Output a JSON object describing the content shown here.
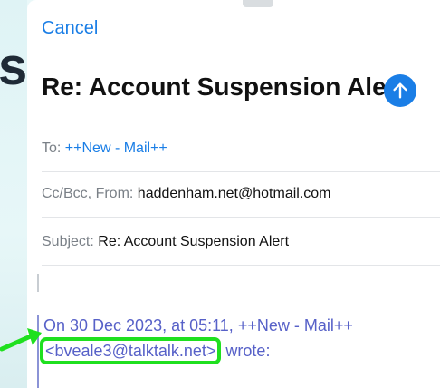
{
  "cancel_label": "Cancel",
  "title": "Re: Account Suspension Alert",
  "to_label": "To:",
  "to_value": "++New - Mail++",
  "cc_label": "Cc/Bcc, From:",
  "from_value": "haddenham.net@hotmail.com",
  "subject_label": "Subject:",
  "subject_value": "Re: Account Suspension Alert",
  "quote_line1": "On 30 Dec 2023, at 05:11, ++New - Mail++",
  "quote_email": "<bveale3@talktalk.net>",
  "quote_tail": "wrote:",
  "bg_glyph": "s",
  "colors": {
    "accent": "#1a7ee6",
    "quote": "#5761c8",
    "highlight": "#1fe01f"
  }
}
